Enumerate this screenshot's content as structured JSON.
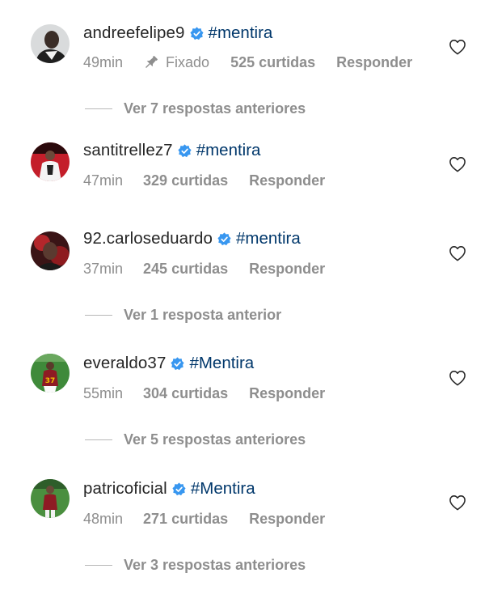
{
  "colors": {
    "text": "#262626",
    "muted": "#8e8e8e",
    "hashtag": "#00376b",
    "verified": "#3897f0"
  },
  "comments": [
    {
      "username": "andreefelipe9",
      "verified": true,
      "text": "#mentira",
      "time": "49min",
      "pinned_label": "Fixado",
      "likes": "525 curtidas",
      "reply": "Responder",
      "view_replies": "Ver 7 respostas anteriores"
    },
    {
      "username": "santitrellez7",
      "verified": true,
      "text": "#mentira",
      "time": "47min",
      "likes": "329 curtidas",
      "reply": "Responder"
    },
    {
      "username": "92.carloseduardo",
      "verified": true,
      "text": "#mentira",
      "time": "37min",
      "likes": "245 curtidas",
      "reply": "Responder",
      "view_replies": "Ver 1 resposta anterior"
    },
    {
      "username": "everaldo37",
      "verified": true,
      "text": "#Mentira",
      "time": "55min",
      "likes": "304 curtidas",
      "reply": "Responder",
      "view_replies": "Ver 5 respostas anteriores"
    },
    {
      "username": "patricoficial",
      "verified": true,
      "text": "#Mentira",
      "time": "48min",
      "likes": "271 curtidas",
      "reply": "Responder",
      "view_replies": "Ver 3 respostas anteriores"
    }
  ],
  "icons": {
    "verified": "verified-badge-icon",
    "pin": "pin-icon",
    "like": "heart-outline-icon"
  }
}
